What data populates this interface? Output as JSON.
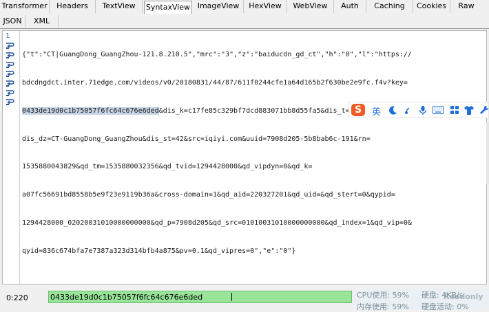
{
  "tabs_row1": [
    "Transformer",
    "Headers",
    "TextView",
    "SyntaxView",
    "ImageView",
    "HexView",
    "WebView",
    "Auth",
    "Caching",
    "Cookies",
    "Raw"
  ],
  "tabs_row1_active": "SyntaxView",
  "tabs_row2": [
    "JSON",
    "XML"
  ],
  "editor": {
    "line_number": "1",
    "lines": [
      "{\"t\":\"CT|GuangDong_GuangZhou-121.8.210.5\",\"mrc\":\"3\",\"z\":\"baiducdn_gd_ct\",\"h\":\"0\",\"l\":\"https://",
      "bdcdngdct.inter.71edge.com/videos/v0/20180831/44/87/611f0244cfe1a64d165b2f630be2e9fc.f4v?key=",
      "&dis_k=c17fe85c329bf7dcd883071bb8d55fa5&dis_t=1535880044&",
      "dis_dz=CT-GuangDong_GuangZhou&dis_st=42&src=iqiyi.com&uuid=7908d205-5b8bab6c-191&rn=",
      "1535880043829&qd_tm=1535880032356&qd_tvid=1294428000&qd_vipdyn=0&qd_k=",
      "a07fc56691bd8558b5e9f23e9119b36a&cross-domain=1&qd_aid=220327201&qd_uid=&qd_stert=0&qypid=",
      "1294428000_02020031010000000000&qd_p=7908d205&qd_src=01010031010000000000&qd_index=1&qd_vip=0&",
      "qyid=836c674bfa7e7387a323d314bfb4a875&pv=0.1&qd_vipres=0\",\"e\":\"0\"}"
    ],
    "selected_text": "0433de19d0c1b75057f6fc64c676e6ded"
  },
  "ime_toolbar": {
    "logo": "S",
    "lang": "英",
    "icons": [
      "moon-icon",
      "punctuation-icon",
      "microphone-icon",
      "keyboard-icon",
      "grid-icon",
      "shirt-icon",
      "wrench-icon"
    ]
  },
  "status": {
    "position": "0:220",
    "quickexec_value": "0433de19d0c1b75057f6fc64c676e6ded",
    "readonly_label": "Readonly",
    "cpu": "CPU使用: 59%",
    "disk": "硬盘: 4KB/s",
    "mem": "内存使用: 59%",
    "disk_activity": "硬盘活动: 0%"
  },
  "colors": {
    "quickexec_bg": "#98e59a",
    "selection": "#c7d4e6",
    "ime_logo": "#f15a24"
  }
}
